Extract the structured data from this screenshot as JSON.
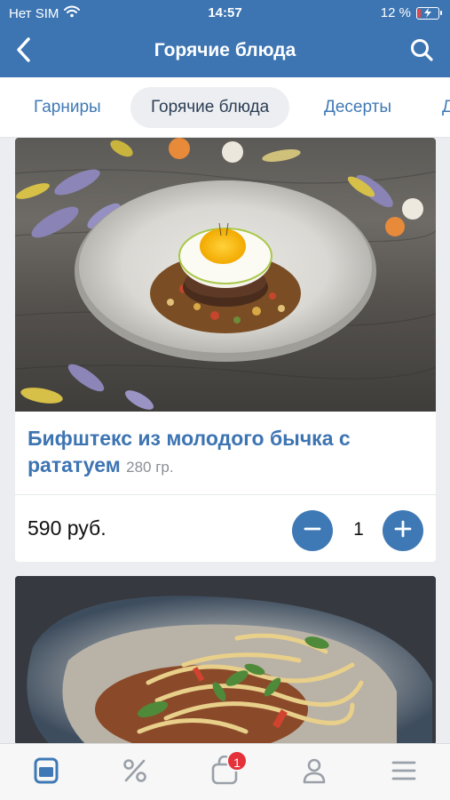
{
  "status_bar": {
    "carrier": "Нет SIM",
    "time": "14:57",
    "battery_percent": "12 %",
    "battery_level": 0.12,
    "battery_color": "#e64646"
  },
  "navbar": {
    "title": "Горячие блюда",
    "back_icon": "chevron-left-icon",
    "search_icon": "search-icon"
  },
  "colors": {
    "header": "#3d75b3",
    "accent": "#3f79b5",
    "badge": "#e4313a"
  },
  "category_tabs": [
    {
      "label": "Гарниры",
      "active": false
    },
    {
      "label": "Горячие блюда",
      "active": true
    },
    {
      "label": "Десерты",
      "active": false
    },
    {
      "label": "Д",
      "active": false
    }
  ],
  "products": [
    {
      "name": "Бифштекс из молодого бычка с рататуем",
      "weight": "280 гр.",
      "price": "590 руб.",
      "quantity": "1"
    },
    {
      "name": "",
      "weight": "",
      "price": "",
      "quantity": ""
    }
  ],
  "bottom_nav": {
    "items": [
      {
        "icon": "menu-book-icon",
        "active": true
      },
      {
        "icon": "percent-icon",
        "active": false
      },
      {
        "icon": "cart-icon",
        "active": false,
        "badge": "1"
      },
      {
        "icon": "profile-icon",
        "active": false
      },
      {
        "icon": "hamburger-menu-icon",
        "active": false
      }
    ]
  }
}
